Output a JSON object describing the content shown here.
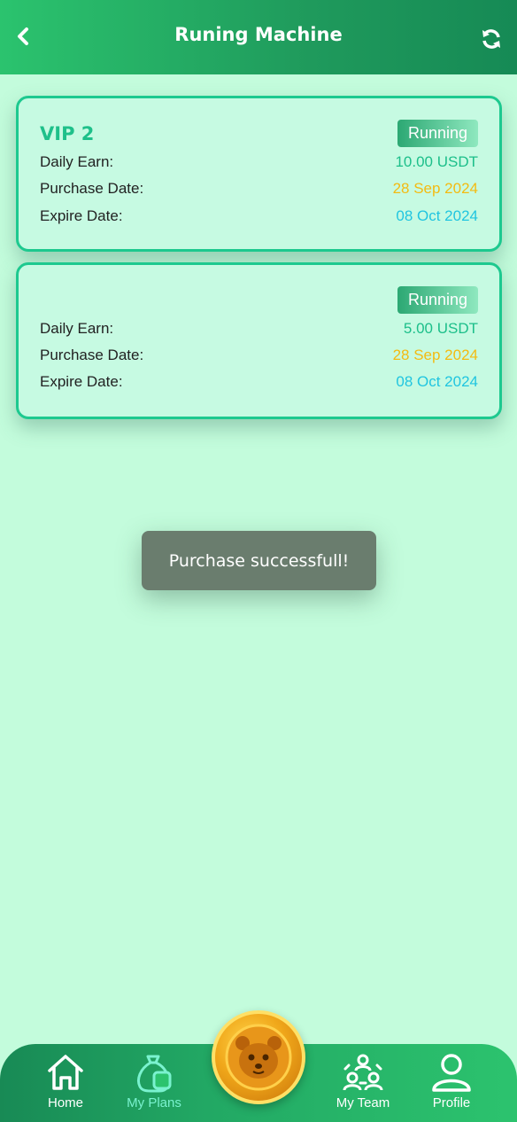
{
  "header": {
    "title": "Runing Machine",
    "back_icon": "chevron-left-icon",
    "refresh_icon": "refresh-icon"
  },
  "plans": [
    {
      "name": "VIP 2",
      "status": "Running",
      "daily_earn_label": "Daily Earn:",
      "daily_earn": "10.00 USDT",
      "purchase_label": "Purchase Date:",
      "purchase_date": "28 Sep 2024",
      "expire_label": "Expire Date:",
      "expire_date": "08 Oct 2024"
    },
    {
      "name": "",
      "status": "Running",
      "daily_earn_label": "Daily Earn:",
      "daily_earn": "5.00 USDT",
      "purchase_label": "Purchase Date:",
      "purchase_date": "28 Sep 2024",
      "expire_label": "Expire Date:",
      "expire_date": "08 Oct 2024"
    }
  ],
  "toast": "Purchase successfull!",
  "colors": {
    "background": "#c3fcdc",
    "accent": "#1dc98f",
    "purchase_date": "#f3bb12",
    "expire_date": "#20c5e0"
  },
  "nav": {
    "items": [
      {
        "label": "Home",
        "icon": "home-icon"
      },
      {
        "label": "My Plans",
        "icon": "plans-bag-icon",
        "active": true
      },
      {
        "label": "My Team",
        "icon": "team-icon"
      },
      {
        "label": "Profile",
        "icon": "profile-icon"
      }
    ],
    "center_icon": "hamster-coin-icon"
  }
}
